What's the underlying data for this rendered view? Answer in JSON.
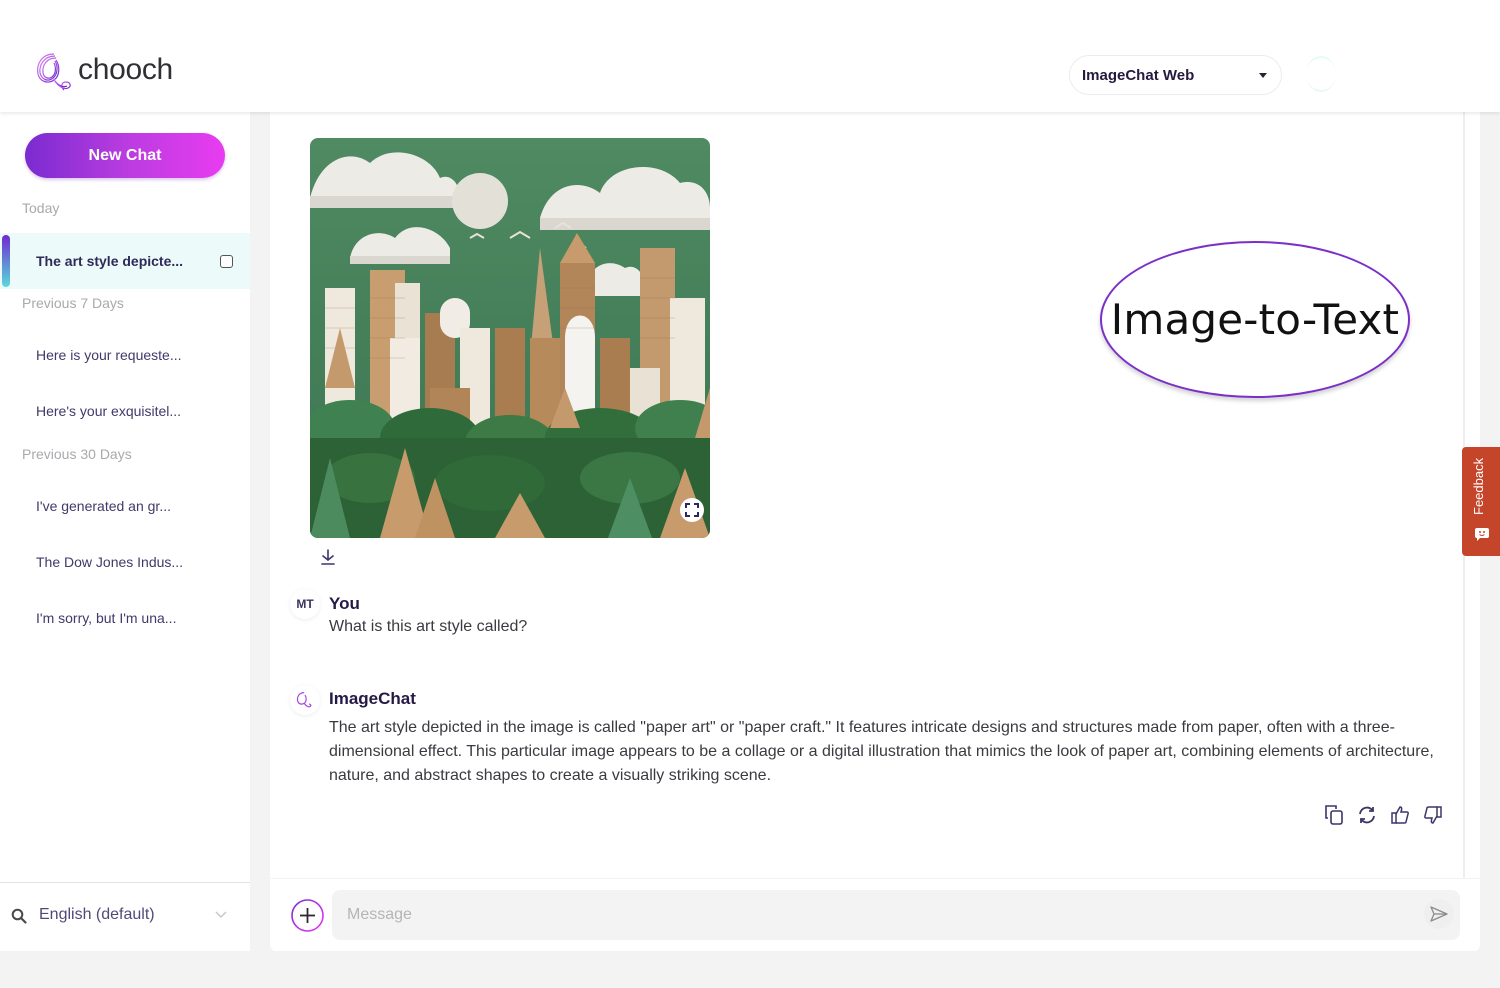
{
  "header": {
    "logo_text": "chooch",
    "model_selector": {
      "selected": "ImageChat Web"
    }
  },
  "sidebar": {
    "new_chat_label": "New Chat",
    "sections": [
      {
        "label": "Today",
        "items": [
          {
            "label": "The art style depicte...",
            "active": true
          }
        ]
      },
      {
        "label": "Previous 7 Days",
        "items": [
          {
            "label": "Here is your requeste..."
          },
          {
            "label": "Here's your exquisitel..."
          }
        ]
      },
      {
        "label": "Previous 30 Days",
        "items": [
          {
            "label": "I've generated an gr..."
          },
          {
            "label": "The Dow Jones Indus..."
          },
          {
            "label": "I'm sorry, but I'm una..."
          }
        ]
      }
    ],
    "language": {
      "selected": "English (default)"
    }
  },
  "conversation": {
    "image": {
      "description": "Paper art cityscape with skyscrapers, clouds, birds and forest",
      "colors": {
        "sky": "#3f7a55",
        "building": "#b58b5c",
        "cloud": "#e8e6e1",
        "tree": "#c49a6c",
        "forest": "#2f6b3a"
      }
    },
    "user_message": {
      "avatar_initials": "MT",
      "author": "You",
      "text": "What is this art style called?"
    },
    "bot_message": {
      "author": "ImageChat",
      "text": "The art style depicted in the image is called \"paper art\" or \"paper craft.\" It features intricate designs and structures made from paper, often with a three-dimensional effect. This particular image appears to be a collage or a digital illustration that mimics the look of paper art, combining elements of architecture, nature, and abstract shapes to create a visually striking scene."
    },
    "actions": [
      "copy-icon",
      "regenerate-icon",
      "thumbs-up-icon",
      "thumbs-down-icon"
    ]
  },
  "annotation": {
    "label": "Image-to-Text",
    "color": "#7b2fc8"
  },
  "feedback_tab": {
    "label": "Feedback",
    "color": "#c5452a"
  },
  "composer": {
    "placeholder": "Message",
    "value": ""
  },
  "colors": {
    "accent_start": "#7a2bd0",
    "accent_end": "#e83cf0",
    "active_bg": "#ecfbf9"
  }
}
